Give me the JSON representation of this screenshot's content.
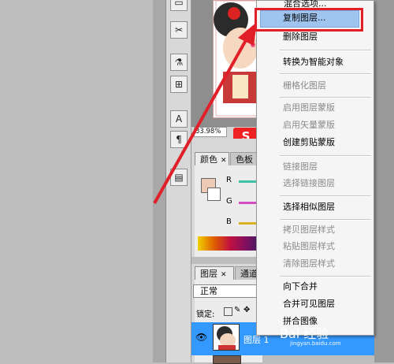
{
  "canvas": {
    "zoom": "33.98%"
  },
  "toolbar": {
    "tools": [
      {
        "glyph": "▭"
      },
      {
        "glyph": "✂"
      },
      {
        "glyph": "⚗"
      },
      {
        "glyph": "⊞"
      },
      {
        "glyph": "A"
      },
      {
        "glyph": "¶"
      },
      {
        "glyph": "▤"
      }
    ]
  },
  "color_panel": {
    "tabs": [
      {
        "label": "颜色"
      },
      {
        "label": "色板"
      }
    ],
    "channels": [
      "R",
      "G",
      "B"
    ]
  },
  "layers_panel": {
    "tabs": [
      {
        "label": "图层"
      },
      {
        "label": "通道"
      }
    ],
    "blend_mode": "正常",
    "lock_label": "锁定:",
    "layer_name": "图层 1"
  },
  "context_menu": {
    "top_partial": "混合选项...",
    "items": [
      {
        "label": "复制图层...",
        "enabled": true,
        "highlighted": true
      },
      {
        "label": "删除图层",
        "enabled": true
      },
      {
        "label": "转换为智能对象",
        "enabled": true
      },
      {
        "label": "栅格化图层",
        "enabled": false
      },
      {
        "label": "启用图层蒙版",
        "enabled": false
      },
      {
        "label": "启用矢量蒙版",
        "enabled": false
      },
      {
        "label": "创建剪贴蒙版",
        "enabled": true
      },
      {
        "label": "链接图层",
        "enabled": false
      },
      {
        "label": "选择链接图层",
        "enabled": false
      },
      {
        "label": "选择相似图层",
        "enabled": true
      },
      {
        "label": "拷贝图层样式",
        "enabled": false
      },
      {
        "label": "粘贴图层样式",
        "enabled": false
      },
      {
        "label": "清除图层样式",
        "enabled": false
      },
      {
        "label": "向下合并",
        "enabled": true
      },
      {
        "label": "合并可见图层",
        "enabled": true
      },
      {
        "label": "拼合图像",
        "enabled": true
      }
    ]
  },
  "watermark": {
    "text": "Bai 经验",
    "url": "jingyan.baidu.com"
  },
  "colors": {
    "highlight": "#9fc4f0",
    "annotation_red": "#e11f28",
    "selected_layer": "#3399ff"
  }
}
